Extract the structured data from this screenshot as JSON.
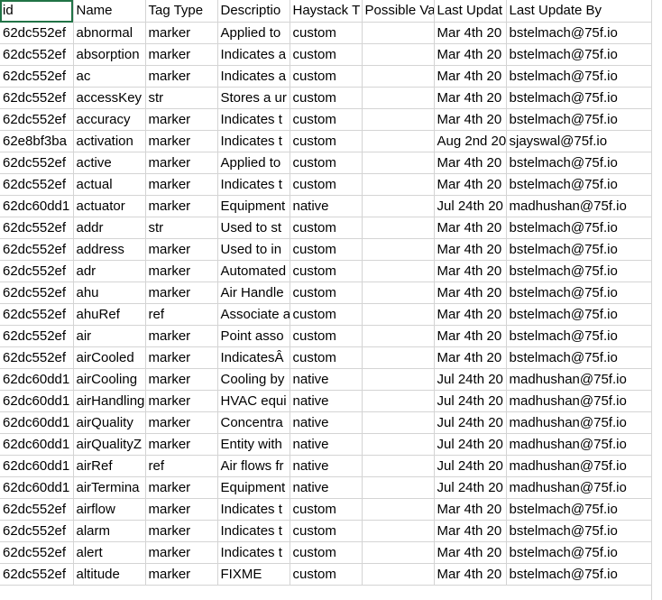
{
  "headers": [
    "id",
    "Name",
    "Tag Type",
    "Descriptio",
    "Haystack T",
    "Possible Va",
    "Last Updat",
    "Last Update By"
  ],
  "rows": [
    [
      "62dc552ef",
      "abnormal",
      "marker",
      "Applied to",
      "custom",
      "",
      "Mar 4th 20",
      "bstelmach@75f.io"
    ],
    [
      "62dc552ef",
      "absorption",
      "marker",
      "Indicates a",
      "custom",
      "",
      "Mar 4th 20",
      "bstelmach@75f.io"
    ],
    [
      "62dc552ef",
      "ac",
      "marker",
      "Indicates a",
      "custom",
      "",
      "Mar 4th 20",
      "bstelmach@75f.io"
    ],
    [
      "62dc552ef",
      "accessKey",
      "str",
      "Stores a ur",
      "custom",
      "",
      "Mar 4th 20",
      "bstelmach@75f.io"
    ],
    [
      "62dc552ef",
      "accuracy",
      "marker",
      "Indicates t",
      "custom",
      "",
      "Mar 4th 20",
      "bstelmach@75f.io"
    ],
    [
      "62e8bf3ba",
      "activation",
      "marker",
      "Indicates t",
      "custom",
      "",
      "Aug 2nd 20",
      "sjayswal@75f.io"
    ],
    [
      "62dc552ef",
      "active",
      "marker",
      "Applied to",
      "custom",
      "",
      "Mar 4th 20",
      "bstelmach@75f.io"
    ],
    [
      "62dc552ef",
      "actual",
      "marker",
      "Indicates t",
      "custom",
      "",
      "Mar 4th 20",
      "bstelmach@75f.io"
    ],
    [
      "62dc60dd1",
      "actuator",
      "marker",
      "Equipment",
      "native",
      "",
      "Jul 24th 20",
      "madhushan@75f.io"
    ],
    [
      "62dc552ef",
      "addr",
      "str",
      "Used to st",
      "custom",
      "",
      "Mar 4th 20",
      "bstelmach@75f.io"
    ],
    [
      "62dc552ef",
      "address",
      "marker",
      "Used to in",
      "custom",
      "",
      "Mar 4th 20",
      "bstelmach@75f.io"
    ],
    [
      "62dc552ef",
      "adr",
      "marker",
      "Automated",
      "custom",
      "",
      "Mar 4th 20",
      "bstelmach@75f.io"
    ],
    [
      "62dc552ef",
      "ahu",
      "marker",
      "Air Handle",
      "custom",
      "",
      "Mar 4th 20",
      "bstelmach@75f.io"
    ],
    [
      "62dc552ef",
      "ahuRef",
      "ref",
      "Associate a",
      "custom",
      "",
      "Mar 4th 20",
      "bstelmach@75f.io"
    ],
    [
      "62dc552ef",
      "air",
      "marker",
      "Point asso",
      "custom",
      "",
      "Mar 4th 20",
      "bstelmach@75f.io"
    ],
    [
      "62dc552ef",
      "airCooled",
      "marker",
      "IndicatesÂ",
      "custom",
      "",
      "Mar 4th 20",
      "bstelmach@75f.io"
    ],
    [
      "62dc60dd1",
      "airCooling",
      "marker",
      "Cooling by",
      "native",
      "",
      "Jul 24th 20",
      "madhushan@75f.io"
    ],
    [
      "62dc60dd1",
      "airHandling",
      "marker",
      "HVAC equi",
      "native",
      "",
      "Jul 24th 20",
      "madhushan@75f.io"
    ],
    [
      "62dc60dd1",
      "airQuality",
      "marker",
      "Concentra",
      "native",
      "",
      "Jul 24th 20",
      "madhushan@75f.io"
    ],
    [
      "62dc60dd1",
      "airQualityZ",
      "marker",
      "Entity with",
      "native",
      "",
      "Jul 24th 20",
      "madhushan@75f.io"
    ],
    [
      "62dc60dd1",
      "airRef",
      "ref",
      "Air flows fr",
      "native",
      "",
      "Jul 24th 20",
      "madhushan@75f.io"
    ],
    [
      "62dc60dd1",
      "airTermina",
      "marker",
      "Equipment",
      "native",
      "",
      "Jul 24th 20",
      "madhushan@75f.io"
    ],
    [
      "62dc552ef",
      "airflow",
      "marker",
      "Indicates t",
      "custom",
      "",
      "Mar 4th 20",
      "bstelmach@75f.io"
    ],
    [
      "62dc552ef",
      "alarm",
      "marker",
      "Indicates t",
      "custom",
      "",
      "Mar 4th 20",
      "bstelmach@75f.io"
    ],
    [
      "62dc552ef",
      "alert",
      "marker",
      "Indicates t",
      "custom",
      "",
      "Mar 4th 20",
      "bstelmach@75f.io"
    ],
    [
      "62dc552ef",
      "altitude",
      "marker",
      "FIXME",
      "custom",
      "",
      "Mar 4th 20",
      "bstelmach@75f.io"
    ]
  ]
}
